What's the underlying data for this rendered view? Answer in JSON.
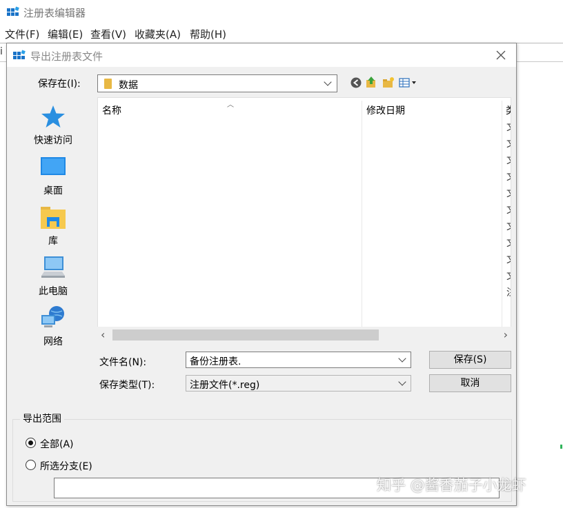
{
  "app": {
    "title": "注册表编辑器",
    "menu": [
      "文件(F)",
      "编辑(E)",
      "查看(V)",
      "收藏夹(A)",
      "帮助(H)"
    ],
    "stub_char": "i"
  },
  "dialog": {
    "title": "导出注册表文件",
    "save_in_label": "保存在(I):",
    "save_in_value": "数据",
    "toolbar_icons": [
      "back-icon",
      "up-folder-icon",
      "new-folder-icon",
      "view-menu-icon"
    ],
    "places": [
      {
        "label": "快速访问",
        "icon": "star-icon"
      },
      {
        "label": "桌面",
        "icon": "desktop-icon"
      },
      {
        "label": "库",
        "icon": "library-icon"
      },
      {
        "label": "此电脑",
        "icon": "computer-icon"
      },
      {
        "label": "网络",
        "icon": "network-icon"
      }
    ],
    "columns": {
      "name": "名称",
      "modified": "修改日期",
      "type": "类"
    },
    "type_glyphs": [
      "文",
      "文",
      "文",
      "文",
      "文",
      "文",
      "文",
      "文",
      "文",
      "文",
      "注"
    ],
    "filename_label": "文件名(N):",
    "filename_value": "备份注册表.",
    "filetype_label": "保存类型(T):",
    "filetype_value": "注册文件(*.reg)",
    "save_button": "保存(S)",
    "cancel_button": "取消",
    "export_range": {
      "title": "导出范围",
      "all_label": "全部(A)",
      "branch_label": "所选分支(E)",
      "selected": "all",
      "branch_value": ""
    }
  },
  "watermark": "知乎 @酱香茄子小龙虾",
  "colors": {
    "accent": "#0078d7",
    "folder": "#e8b844",
    "dialog_bg": "#f0f0f0"
  }
}
